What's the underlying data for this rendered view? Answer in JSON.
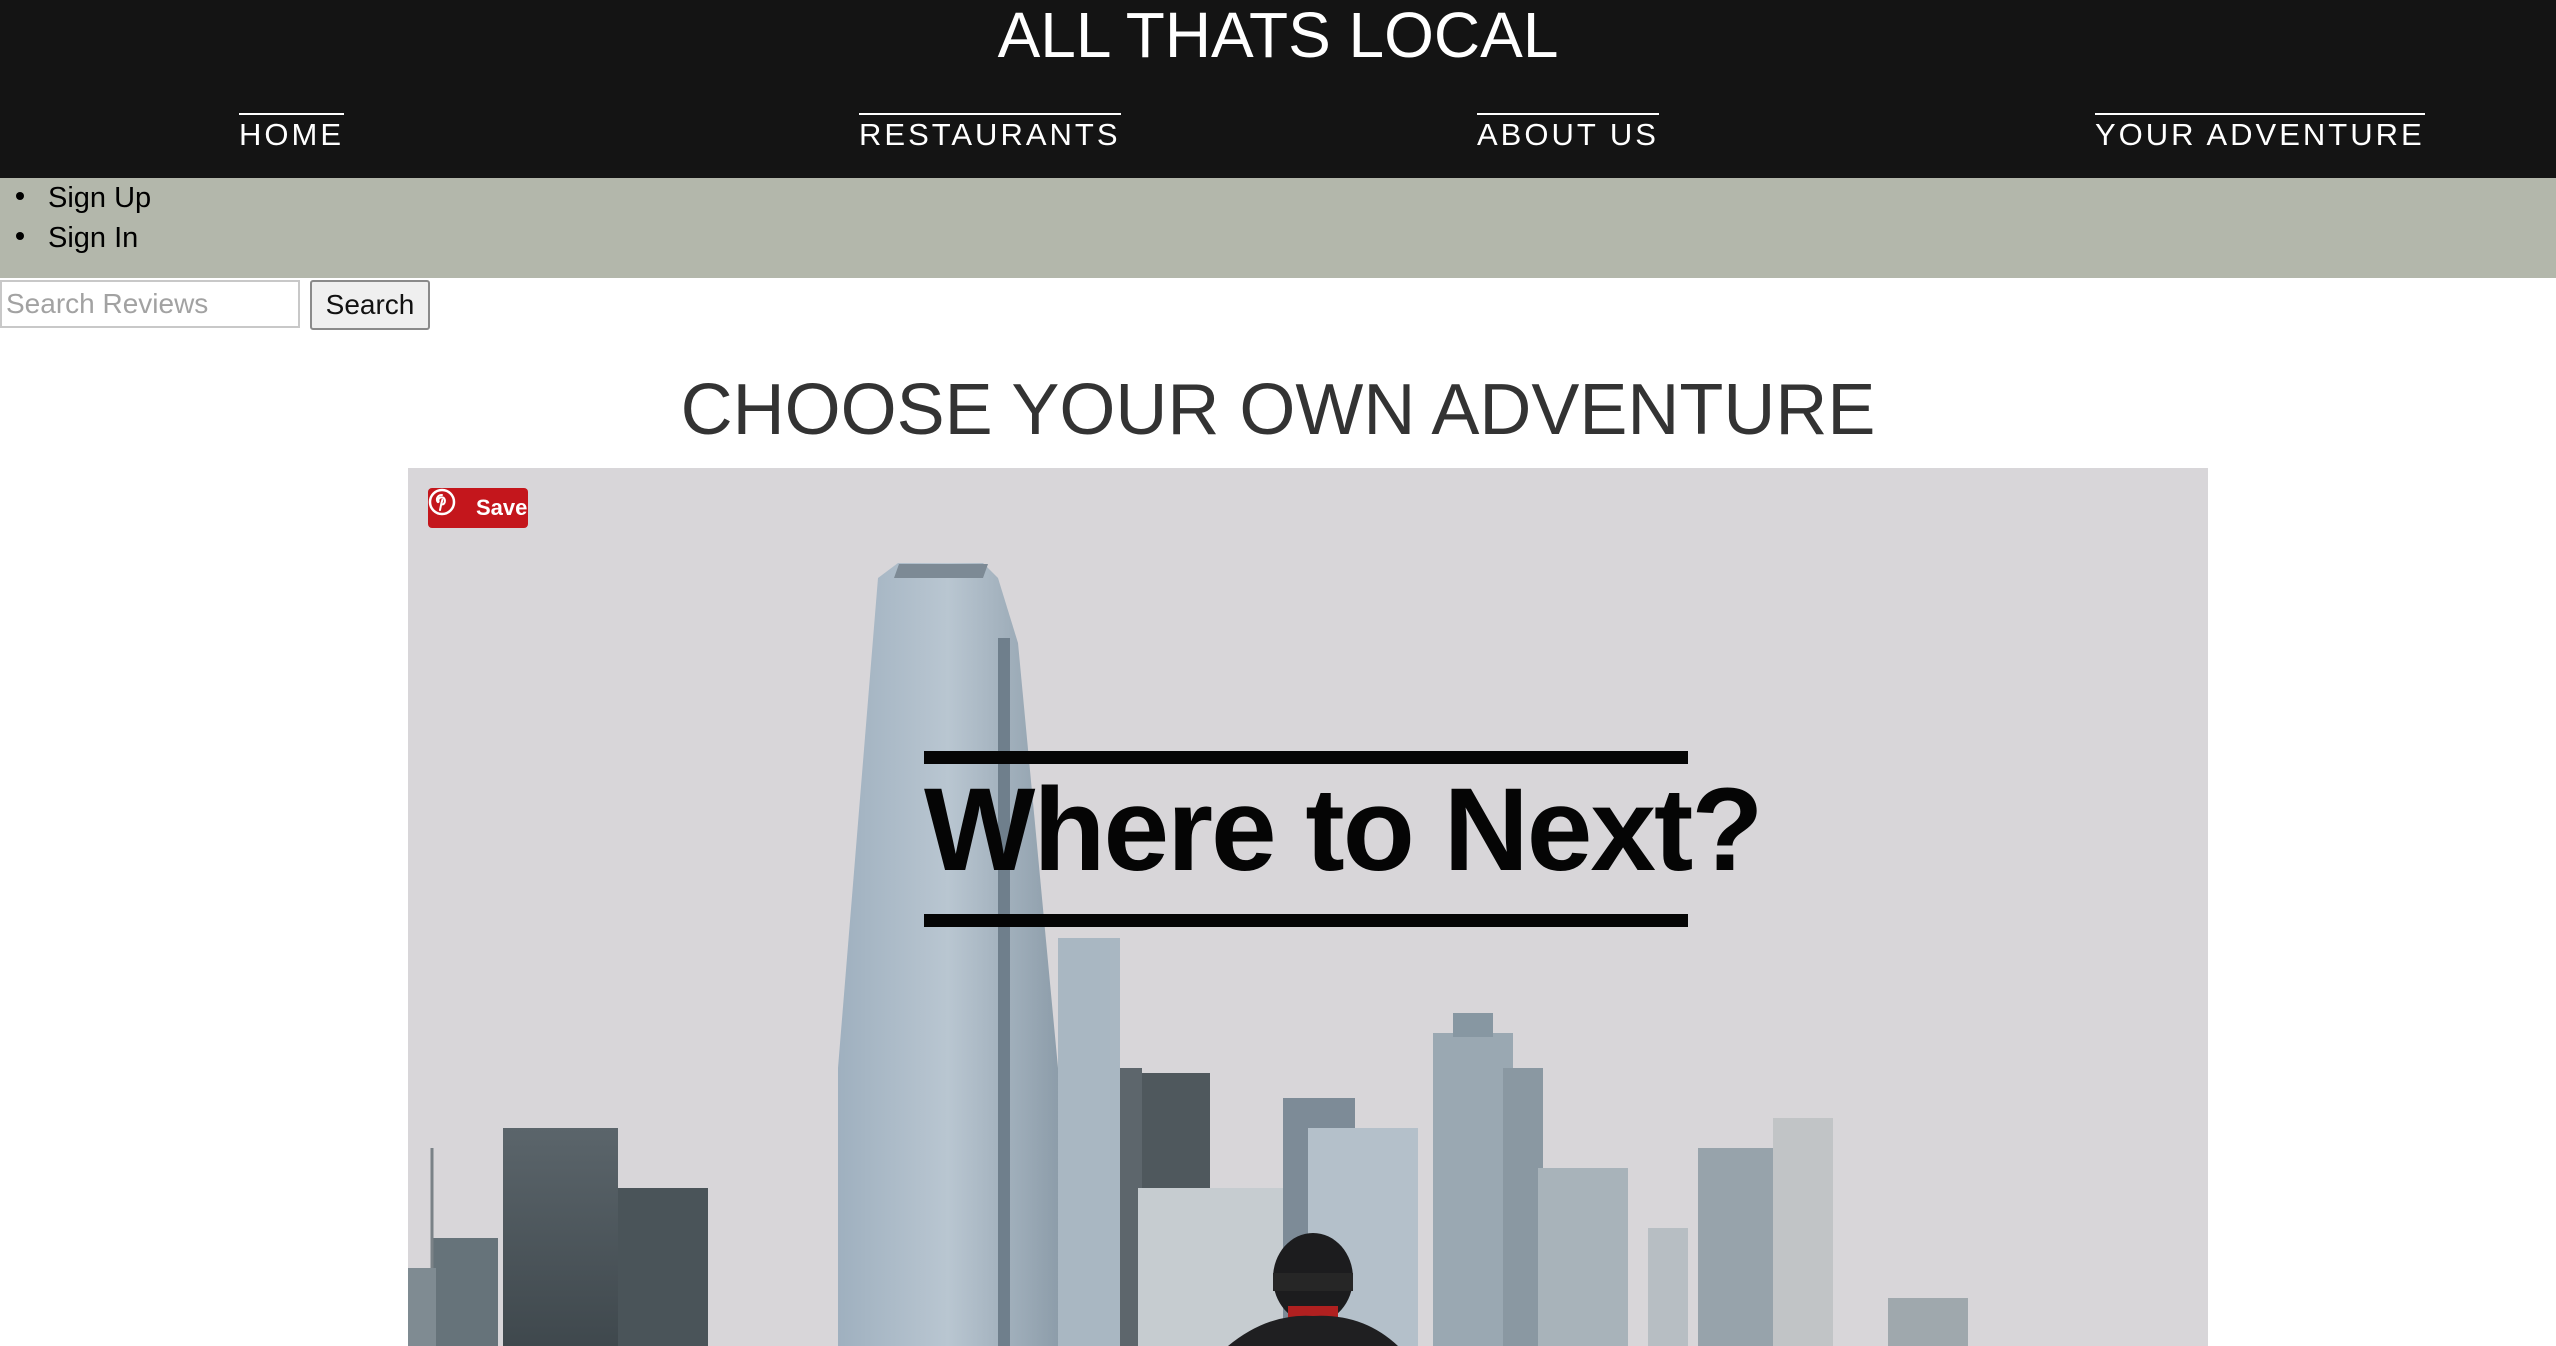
{
  "header": {
    "title": "ALL THATS LOCAL",
    "nav": [
      {
        "label": "HOME"
      },
      {
        "label": "RESTAURANTS"
      },
      {
        "label": "ABOUT US"
      },
      {
        "label": "YOUR ADVENTURE"
      }
    ]
  },
  "auth": {
    "items": [
      {
        "label": "Sign Up"
      },
      {
        "label": "Sign In"
      }
    ]
  },
  "search": {
    "placeholder": "Search Reviews",
    "value": "",
    "button_label": "Search"
  },
  "main": {
    "heading": "CHOOSE YOUR OWN ADVENTURE",
    "hero": {
      "save_label": "Save",
      "overlay_text": "Where to Next?",
      "icons": {
        "pin": "pinterest-icon"
      }
    }
  },
  "colors": {
    "header_bg": "#141414",
    "auth_bar_bg": "#b3b7ab",
    "heading_text": "#333333",
    "pin_red": "#c4161c"
  }
}
